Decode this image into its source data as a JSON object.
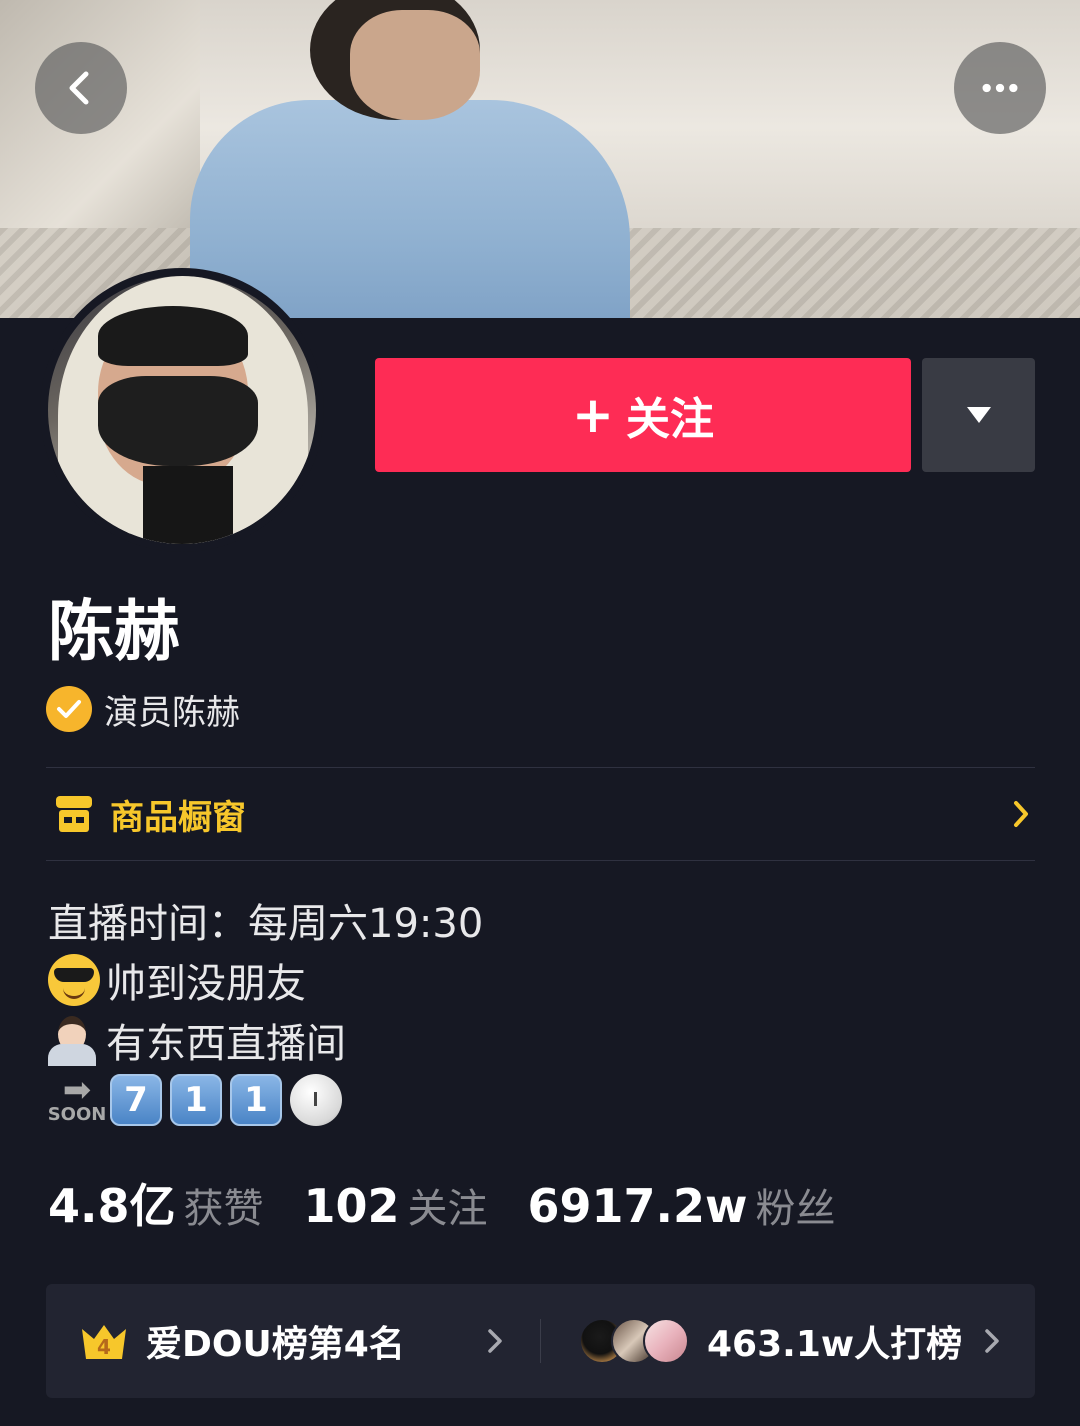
{
  "profile": {
    "name": "陈赫",
    "verification": "演员陈赫"
  },
  "actions": {
    "follow_plus": "+",
    "follow_label": "关注"
  },
  "shop": {
    "label": "商品橱窗"
  },
  "bio": {
    "line1": "直播时间：每周六19:30",
    "line2_text": "帅到没朋友",
    "line2_emoji": "smiling-face-with-sunglasses",
    "line3_text": "有东西直播间",
    "line3_emoji": "person-tipping-hand",
    "line4_soon": "SOON",
    "line4_keycaps": [
      "7",
      "1",
      "1"
    ],
    "line4_clock": "clock-face"
  },
  "stats": {
    "likes_value": "4.8亿",
    "likes_label": "获赞",
    "following_value": "102",
    "following_label": "关注",
    "followers_value": "6917.2w",
    "followers_label": "粉丝"
  },
  "ranking": {
    "crown_rank": "4",
    "rank_label": "爱DOU榜第4名",
    "supporters_label": "463.1w人打榜"
  },
  "colors": {
    "background": "#161823",
    "follow_button": "#fe2c55",
    "verify_badge": "#f7b52c",
    "shop_accent": "#f7c72b",
    "secondary_text": "#8a8b91"
  }
}
